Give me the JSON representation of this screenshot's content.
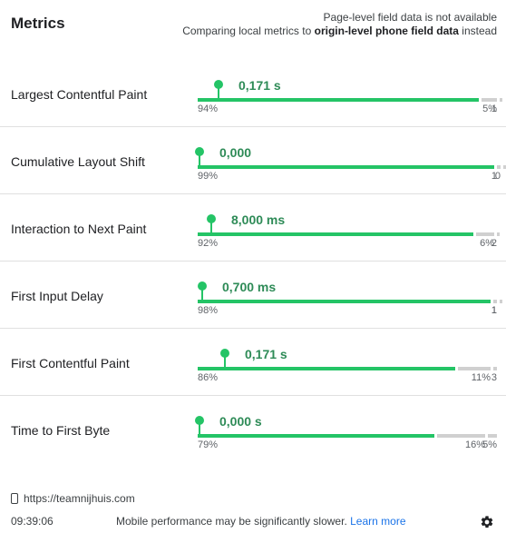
{
  "header": {
    "title": "Metrics",
    "notice_line1": "Page-level field data is not available",
    "notice_line2_prefix": "Comparing local metrics to ",
    "notice_line2_bold": "origin-level phone field data",
    "notice_line2_suffix": " instead"
  },
  "metrics": [
    {
      "name": "Largest Contentful Paint",
      "value": "0,171 s",
      "good_pct": "94%",
      "ni_pct": "5%",
      "poor_pct": "1",
      "good": 0.94,
      "ni": 0.05,
      "poor": 0.01,
      "marker": 0.065
    },
    {
      "name": "Cumulative Layout Shift",
      "value": "0,000",
      "good_pct": "99%",
      "ni_pct": "0",
      "poor_pct": "1",
      "good": 0.99,
      "ni": 0.005,
      "poor": 0.005,
      "marker": 0.0
    },
    {
      "name": "Interaction to Next Paint",
      "value": "8,000 ms",
      "good_pct": "92%",
      "ni_pct": "6%",
      "poor_pct": "2",
      "good": 0.92,
      "ni": 0.06,
      "poor": 0.02,
      "marker": 0.038
    },
    {
      "name": "First Input Delay",
      "value": "0,700 ms",
      "good_pct": "98%",
      "ni_pct": "1",
      "poor_pct": "1",
      "good": 0.98,
      "ni": 0.01,
      "poor": 0.01,
      "marker": 0.01
    },
    {
      "name": "First Contentful Paint",
      "value": "0,171 s",
      "good_pct": "86%",
      "ni_pct": "11%",
      "poor_pct": "3",
      "good": 0.86,
      "ni": 0.11,
      "poor": 0.03,
      "marker": 0.085
    },
    {
      "name": "Time to First Byte",
      "value": "0,000 s",
      "good_pct": "79%",
      "ni_pct": "16%",
      "poor_pct": "5%",
      "good": 0.79,
      "ni": 0.16,
      "poor": 0.05,
      "marker": 0.0
    }
  ],
  "footer": {
    "url": "https://teamnijhuis.com",
    "time": "09:39:06",
    "message": "Mobile performance may be significantly slower.",
    "learn_more": "Learn more"
  },
  "colors": {
    "good": "#24c466",
    "track": "#d0d0d0",
    "value": "#2e8b57",
    "link": "#1a73e8"
  },
  "icons": {
    "device": "phone-icon",
    "settings": "gear-icon"
  }
}
